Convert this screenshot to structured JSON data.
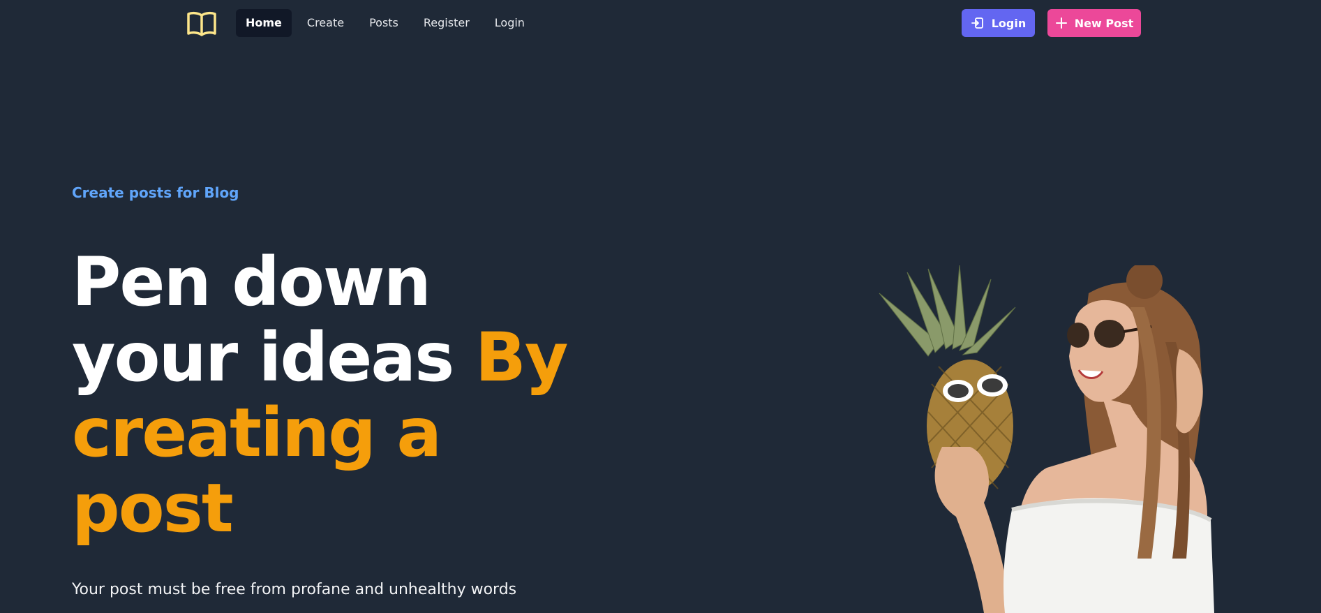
{
  "navbar": {
    "logo_icon": "book-open-icon",
    "links": [
      {
        "label": "Home",
        "active": true
      },
      {
        "label": "Create",
        "active": false
      },
      {
        "label": "Posts",
        "active": false
      },
      {
        "label": "Register",
        "active": false
      },
      {
        "label": "Login",
        "active": false
      }
    ],
    "login_button": {
      "label": "Login",
      "icon": "login-icon"
    },
    "new_post_button": {
      "label": "New Post",
      "icon": "plus-icon"
    }
  },
  "hero": {
    "tagline": "Create posts for Blog",
    "headline_white": "Pen down your ideas",
    "headline_accent": "By creating a post",
    "subtext": "Your post must be free from profane and unhealthy words",
    "image": "woman-with-pineapple-illustration"
  },
  "colors": {
    "background": "#1f2937",
    "tagline": "#60a5fa",
    "accent": "#f59e0b",
    "login_button": "#6366f1",
    "new_post_button": "#ec4899",
    "active_nav": "#111827"
  }
}
